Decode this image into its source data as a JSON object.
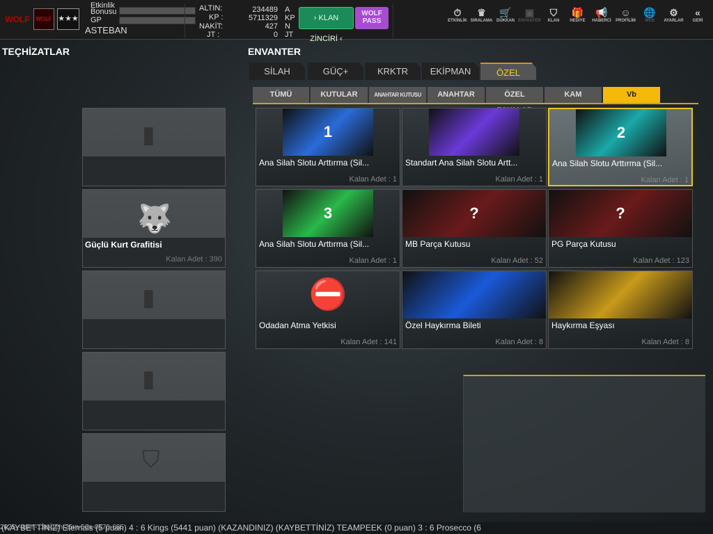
{
  "header": {
    "logo_text": "WOLF",
    "rank_badge": "WOLF",
    "stars": "★★★",
    "event_bonus_label": "Etkinlik Bonusu",
    "gp_label": "GP",
    "username": "ASTEBAN",
    "currencies": [
      {
        "label": "ALTIN:",
        "value": "234489",
        "unit": "A"
      },
      {
        "label": "KP :",
        "value": "5711329",
        "unit": "KP"
      },
      {
        "label": "NAKİT:",
        "value": "427",
        "unit": "N"
      },
      {
        "label": "JT :",
        "value": "0",
        "unit": "JT"
      }
    ],
    "klan_button": "› KLAN ZİNCİRİ ‹",
    "wolf_pass": "WOLF PASS",
    "nav": [
      {
        "label": "ETKİNLİK",
        "icon": "⏱"
      },
      {
        "label": "SIRALAMA",
        "icon": "♛"
      },
      {
        "label": "DÜKKAN",
        "icon": "🛒"
      },
      {
        "label": "ENVANTER",
        "icon": "▣"
      },
      {
        "label": "KLAN",
        "icon": "⛉"
      },
      {
        "label": "HEDİYE",
        "icon": "🎁"
      },
      {
        "label": "HABERCİ",
        "icon": "📢"
      },
      {
        "label": "PROFİLİM",
        "icon": "☺"
      },
      {
        "label": "WEB",
        "icon": "🌐"
      },
      {
        "label": "AYARLAR",
        "icon": "⚙"
      },
      {
        "label": "GERİ",
        "icon": "«"
      }
    ]
  },
  "left": {
    "title": "TEÇHİZATLAR",
    "slots": [
      {
        "name": "",
        "count": ""
      },
      {
        "name": "Güçlü Kurt Grafitisi",
        "count": "Kalan Adet : 390"
      }
    ]
  },
  "inventory": {
    "title": "ENVANTER",
    "tabs": [
      "SİLAH",
      "GÜÇ+",
      "KRKTR",
      "EKİPMAN",
      "ÖZEL"
    ],
    "active_tab": "ÖZEL",
    "subtabs": [
      "TÜMÜ",
      "KUTULAR",
      "ANAHTAR KUTUSU",
      "ANAHTAR",
      "ÖZEL EŞYALAR",
      "KAM",
      "Vb"
    ],
    "active_subtab": "Vb",
    "items": [
      {
        "name": "Ana Silah Slotu Arttırma (Sil...",
        "count": "Kalan Adet : 1",
        "badge": "1",
        "color": "#2a6cd8"
      },
      {
        "name": "Standart Ana Silah Slotu Artt...",
        "count": "Kalan Adet : 1",
        "badge": "",
        "color": "#6a3ad8"
      },
      {
        "name": "Ana Silah Slotu Arttırma (Sil...",
        "count": "Kalan Adet : 1",
        "badge": "2",
        "color": "#1aa8a8"
      },
      {
        "name": "Ana Silah Slotu Arttırma (Sil...",
        "count": "Kalan Adet : 1",
        "badge": "3",
        "color": "#2ab84a"
      },
      {
        "name": "MB Parça Kutusu",
        "count": "Kalan Adet : 52",
        "badge": "?",
        "color": "#6a1a1a"
      },
      {
        "name": "PG Parça Kutusu",
        "count": "Kalan Adet : 123",
        "badge": "?",
        "color": "#6a1a1a"
      },
      {
        "name": "Odadan Atma Yetkisi",
        "count": "Kalan Adet : 141",
        "badge": "⛔",
        "color": "#444"
      },
      {
        "name": "Özel Haykırma Bileti",
        "count": "Kalan Adet : 8",
        "badge": "",
        "color": "#1a5ad8"
      },
      {
        "name": "Haykırma Eşyası",
        "count": "Kalan Adet : 8",
        "badge": "",
        "color": "#c89a1a"
      }
    ]
  },
  "ticker": "(KAYBETTİNİZ) Eternals (5 puan) 4 : 6 Kings (5441 puan) (KAZANDINIZ)          (KAYBETTİNİZ) TEAMPEEK (0 puan) 3 : 6 Prosecco (6",
  "timestamp": "2025y-10m-13d-12h-25m-56s-0570-685"
}
